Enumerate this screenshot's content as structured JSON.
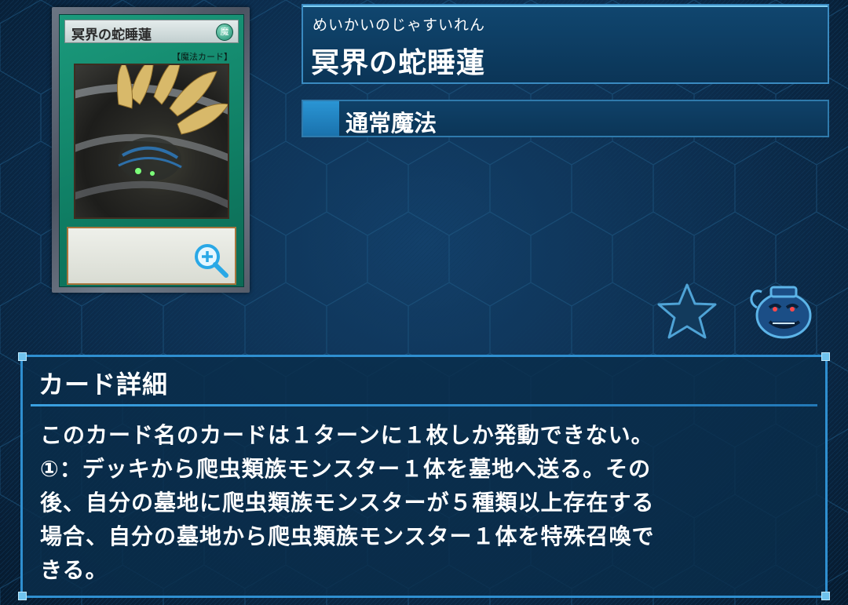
{
  "card": {
    "reading": "めいかいのじゃすいれん",
    "name": "冥界の蛇睡蓮",
    "art_name": "冥界の蛇睡蓮",
    "art_attribute": "魔",
    "art_type": "【魔法カード】",
    "spell_type": "通常魔法"
  },
  "detail": {
    "header": "カード詳細",
    "text": "このカード名のカードは１ターンに１枚しか発動できない。\n①：デッキから爬虫類族モンスター１体を墓地へ送る。その\n後、自分の墓地に爬虫類族モンスターが５種類以上存在する\n場合、自分の墓地から爬虫類族モンスター１体を特殊召喚で\nきる。"
  },
  "icons": {
    "zoom": "zoom-in-icon",
    "favorite": "star-icon",
    "pot": "pot-of-greed-icon"
  },
  "colors": {
    "background": "#0c2c4c",
    "panel_border": "#2f8fd0",
    "spell_card_green": "#1b9a7c",
    "type_swatch": "#2a95d4"
  }
}
